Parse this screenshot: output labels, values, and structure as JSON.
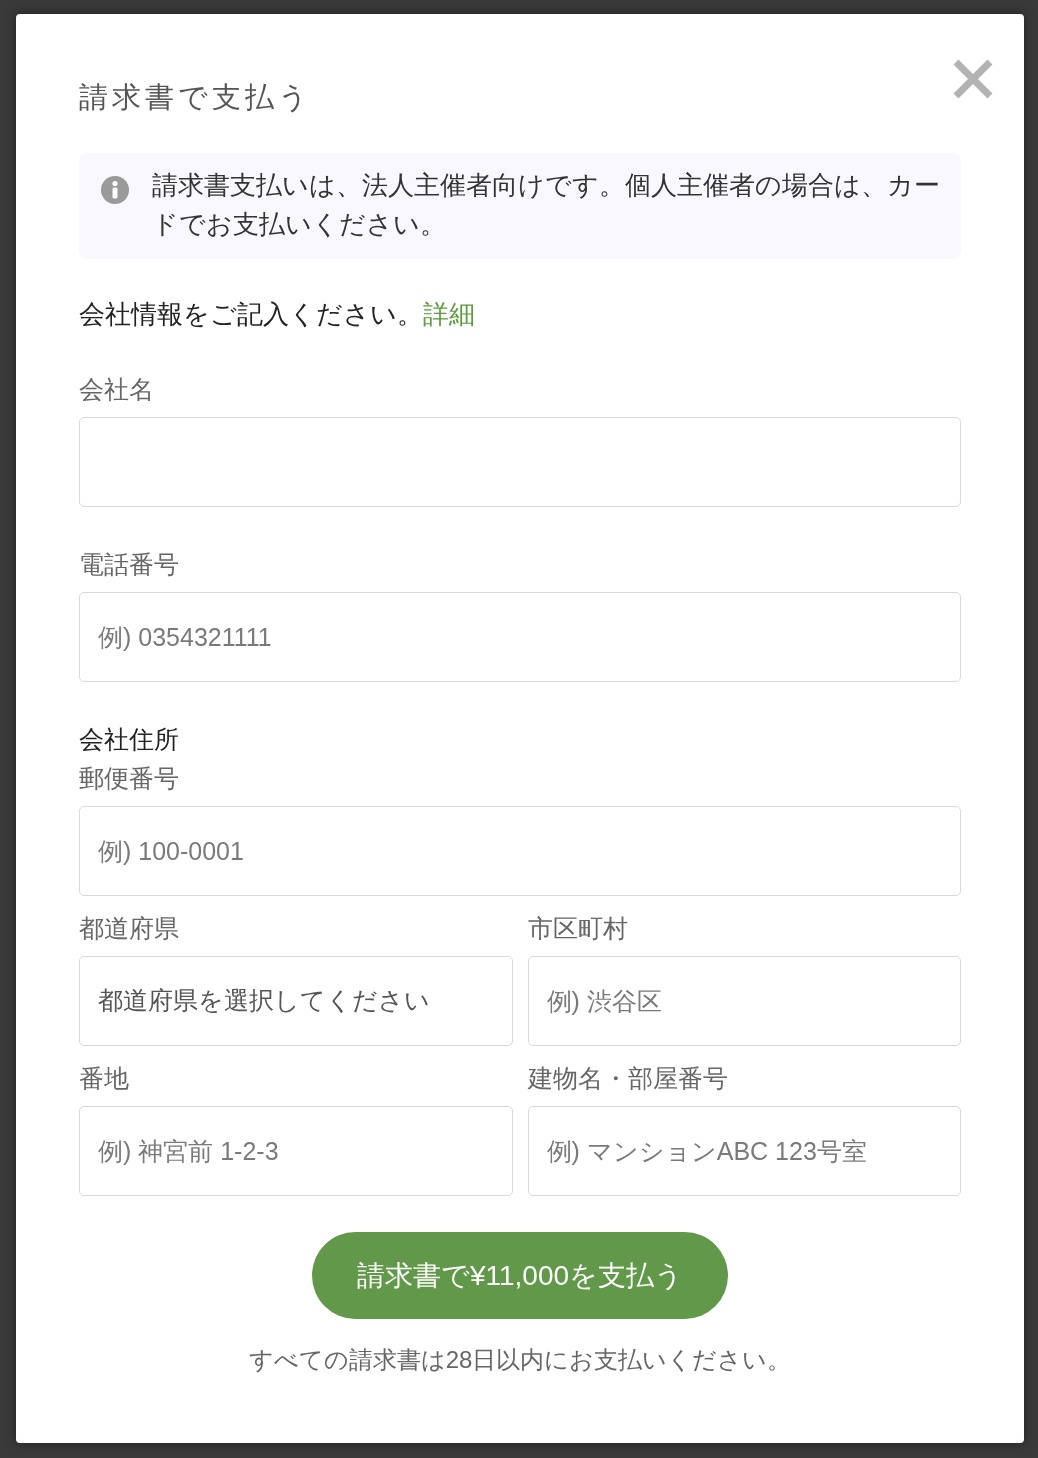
{
  "dialog": {
    "title": "請求書で支払う"
  },
  "notice": {
    "text": "請求書支払いは、法人主催者向けです。個人主催者の場合は、カードでお支払いください。"
  },
  "intro": {
    "text": "会社情報をご記入ください。",
    "link": "詳細"
  },
  "company_fields": [
    {
      "label": "会社名",
      "kind": "input"
    },
    {
      "label": "電話番号",
      "kind": "input",
      "placeholder": "例) 0354321111"
    }
  ],
  "address": {
    "heading": "会社住所",
    "rows": [
      {
        "fields": [
          {
            "label": "郵便番号",
            "kind": "input",
            "placeholder": "例) 100-0001"
          }
        ]
      },
      {
        "fields": [
          {
            "label": "都道府県",
            "kind": "select",
            "value": "都道府県を選択してください"
          },
          {
            "label": "市区町村",
            "kind": "input",
            "placeholder": "例) 渋谷区"
          }
        ]
      },
      {
        "fields": [
          {
            "label": "番地",
            "kind": "input",
            "placeholder": "例) 神宮前 1-2-3"
          },
          {
            "label": "建物名・部屋番号",
            "kind": "input",
            "placeholder": "例) マンションABC 123号室"
          }
        ]
      }
    ]
  },
  "submit_button": {
    "label": "請求書で¥11,000を支払う"
  },
  "footnote": "すべての請求書は28日以内にお支払いください。"
}
